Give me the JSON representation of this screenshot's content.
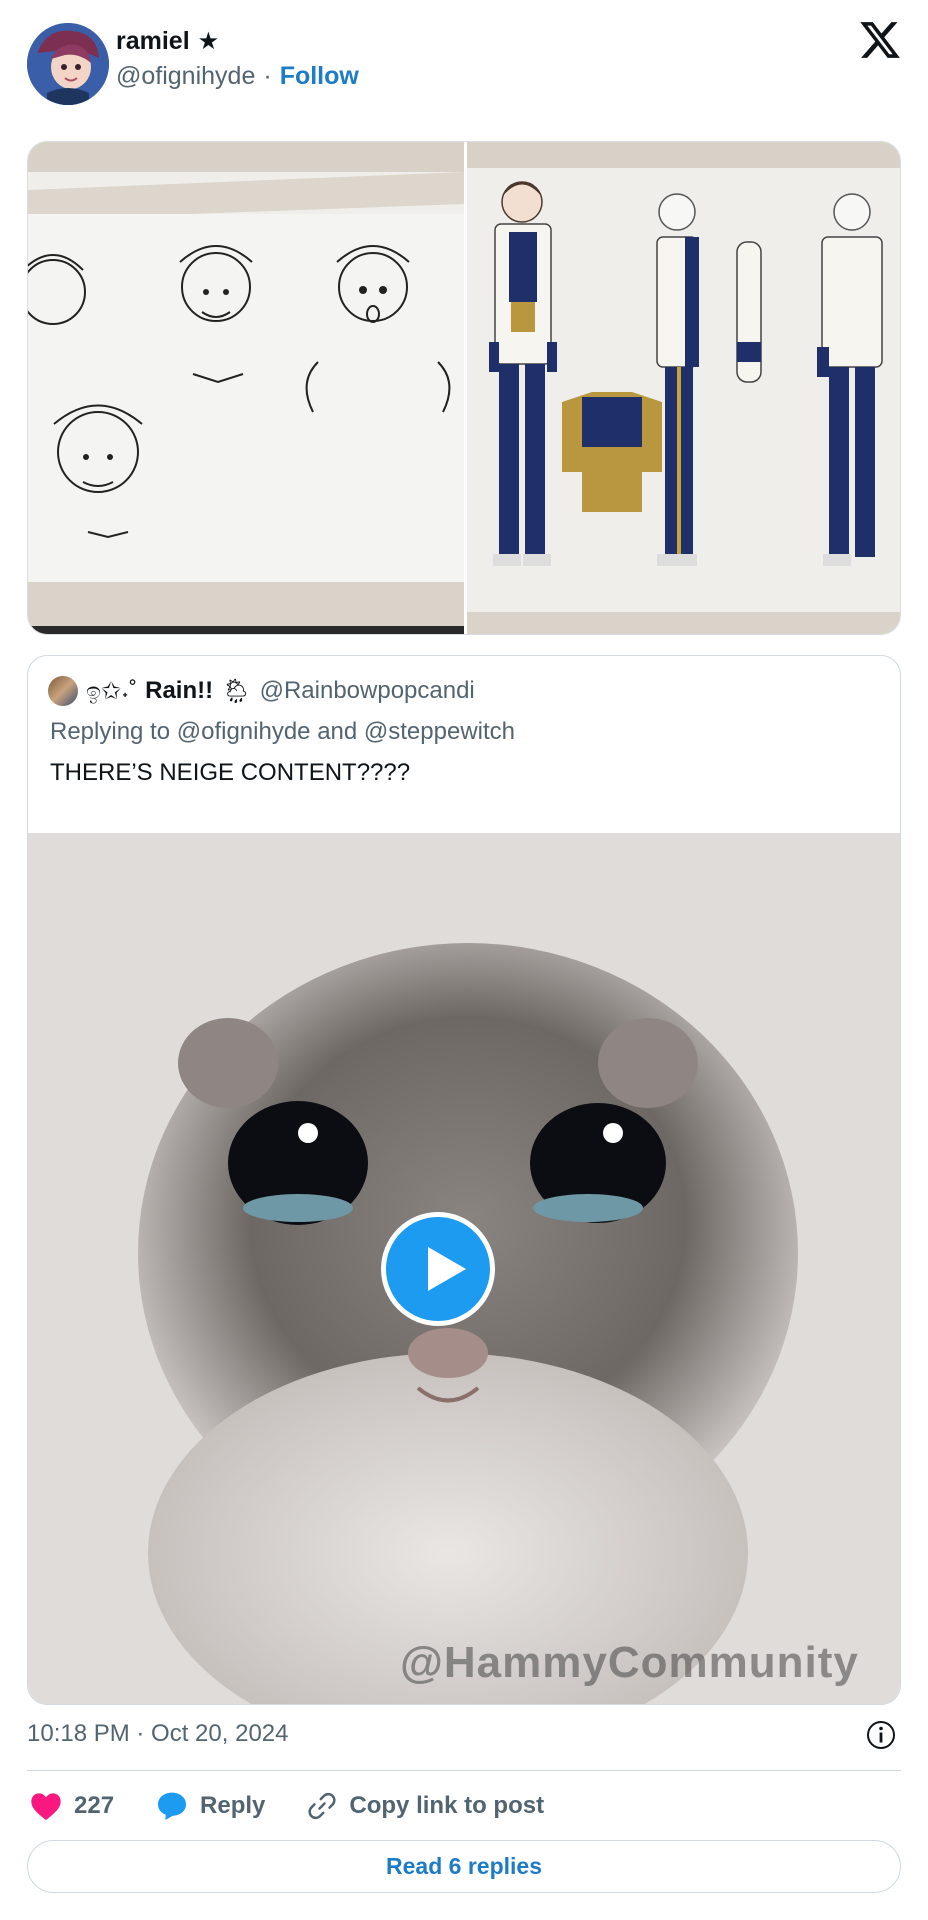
{
  "author": {
    "display_name": "ramiel",
    "badge": "★",
    "handle": "@ofignihyde",
    "separator": "·",
    "follow_label": "Follow"
  },
  "quote": {
    "emoji_prefix": "ඉ✩˖˚",
    "display_name": "Rain!!",
    "weather_emoji": "🌦",
    "handle": "@Rainbowpopcandi",
    "reply_line": "Replying to @ofignihyde and @steppewitch",
    "text": "THERE’S NEIGE CONTENT????",
    "video_watermark": "@HammyCommunity"
  },
  "footer": {
    "timestamp": "10:18 PM · Oct 20, 2024",
    "like_count": "227",
    "reply_label": "Reply",
    "copy_label": "Copy link to post",
    "read_replies_label": "Read 6 replies"
  },
  "colors": {
    "link": "#1d7bc7",
    "like": "#f91880",
    "reply": "#1d9bf0",
    "muted": "#536471"
  },
  "icons": [
    "x-logo-icon",
    "star-icon",
    "info-icon",
    "heart-icon",
    "reply-bubble-icon",
    "link-icon",
    "play-icon"
  ]
}
